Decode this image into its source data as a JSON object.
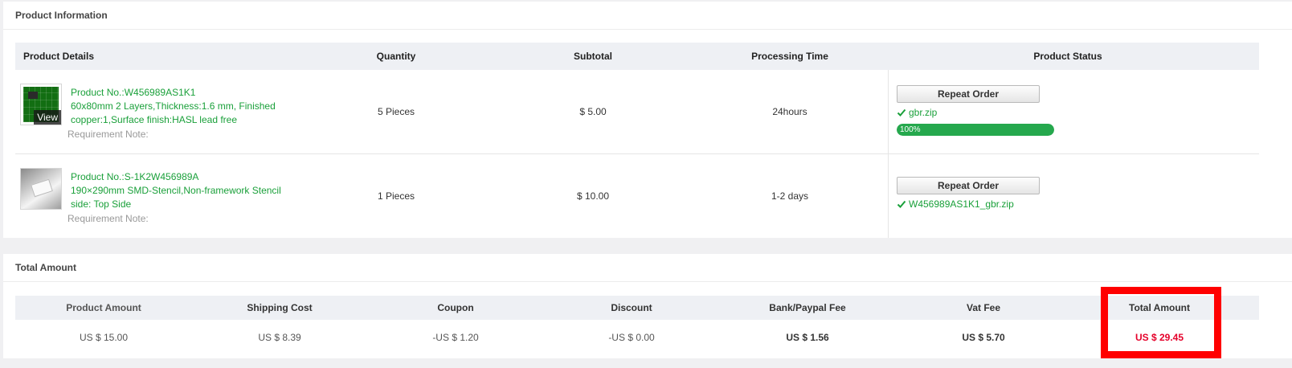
{
  "product_info": {
    "title": "Product Information",
    "headers": {
      "details": "Product Details",
      "quantity": "Quantity",
      "subtotal": "Subtotal",
      "processing": "Processing Time",
      "status": "Product Status"
    },
    "rows": [
      {
        "product_no": "Product No.:W456989AS1K1",
        "description": "60x80mm 2 Layers,Thickness:1.6 mm, Finished copper:1,Surface finish:HASL lead free",
        "requirement": "Requirement Note:",
        "view_label": "View",
        "quantity": "5 Pieces",
        "subtotal": "$ 5.00",
        "processing": "24hours",
        "repeat_label": "Repeat Order",
        "file": "gbr.zip",
        "progress_label": "100%",
        "progress_value": 1.0
      },
      {
        "product_no": "Product No.:S-1K2W456989A",
        "description": "190×290mm SMD-Stencil,Non-framework Stencil side: Top Side",
        "requirement": "Requirement Note:",
        "quantity": "1 Pieces",
        "subtotal": "$ 10.00",
        "processing": "1-2 days",
        "repeat_label": "Repeat Order",
        "file": "W456989AS1K1_gbr.zip"
      }
    ]
  },
  "total_amount": {
    "title": "Total Amount",
    "headers": {
      "product_amount": "Product Amount",
      "shipping": "Shipping Cost",
      "coupon": "Coupon",
      "discount": "Discount",
      "bank_fee": "Bank/Paypal Fee",
      "vat": "Vat Fee",
      "total": "Total Amount"
    },
    "values": {
      "product_amount": "US $ 15.00",
      "shipping": "US $ 8.39",
      "coupon": "-US $ 1.20",
      "discount": "-US $ 0.00",
      "bank_fee": "US $ 1.56",
      "vat": "US $ 5.70",
      "total": "US $ 29.45"
    }
  },
  "colors": {
    "accent_green": "#1aa03a",
    "total_red": "#e5002a",
    "highlight": "#ff0000"
  }
}
